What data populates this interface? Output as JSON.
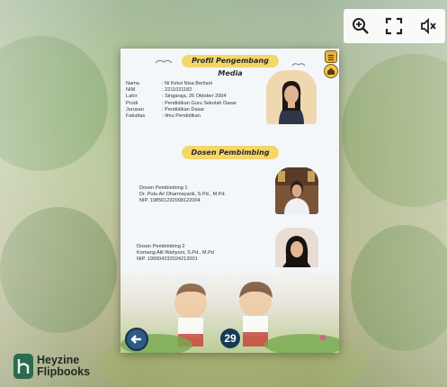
{
  "toolbar": {
    "zoom_icon": "zoom-in-icon",
    "fullscreen_icon": "fullscreen-icon",
    "mute_icon": "speaker-muted-icon"
  },
  "page": {
    "profile_title": "Profil Pengembang Media",
    "developer": {
      "rows": [
        {
          "key": "Nama",
          "value": ": Ni Ketut Nisa Berliani"
        },
        {
          "key": "NIM",
          "value": ": 2211031182"
        },
        {
          "key": "Lahir",
          "value": ": Singaraja, 26 Oktober 2004"
        },
        {
          "key": "Prodi",
          "value": ": Pendidikan Guru Sekolah Dasar"
        },
        {
          "key": "Jurusan",
          "value": ": Pendidikan Dasar"
        },
        {
          "key": "Fakultas",
          "value": ": Ilmu Pendidikan"
        }
      ]
    },
    "advisors_title": "Dosen Pembimbing",
    "advisor1": {
      "role": "Dosen Pembimbing 1",
      "name": "Dr. Putu Ari Dharmayanti, S.Pd., M.Pd.",
      "nip": "NIP. 198501232008122004"
    },
    "advisor2": {
      "role": "Dosen Pembimbing 2",
      "name": "Komang Alit Wahyuni, S.Pd., M.Pd",
      "nip": "NIP. 199904232024212001"
    },
    "page_number": "29"
  },
  "brand": {
    "line1": "Heyzine",
    "line2": "Flipbooks"
  },
  "colors": {
    "banner": "#f5d769",
    "page_button": "#173b57"
  }
}
